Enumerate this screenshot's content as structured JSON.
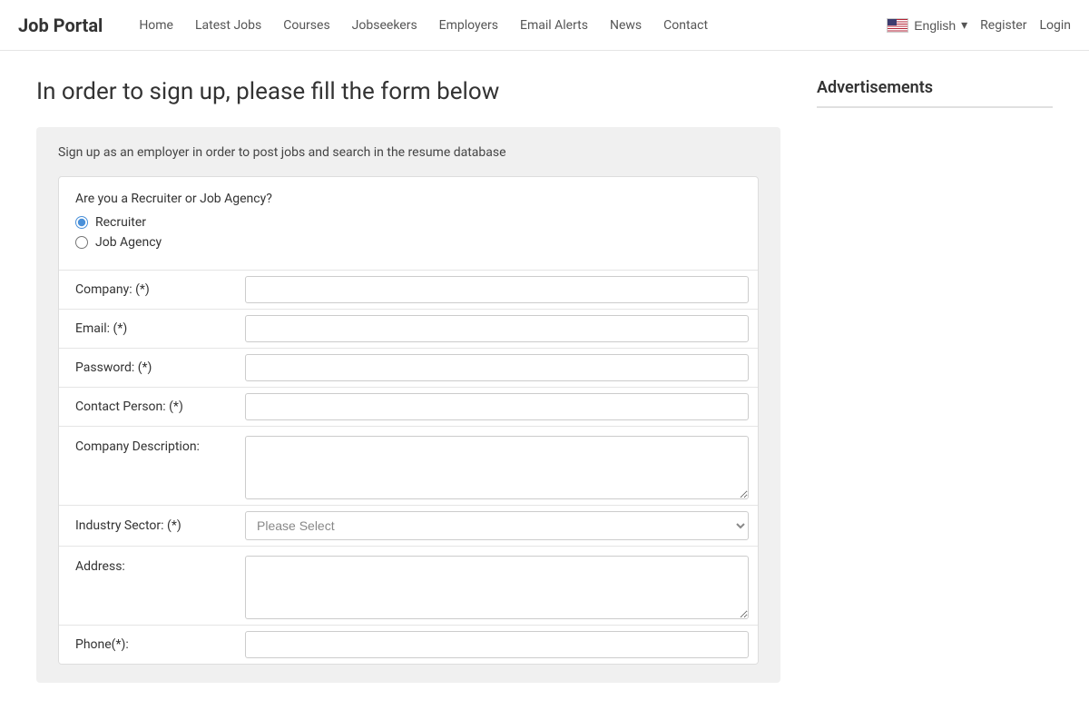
{
  "brand": "Job Portal",
  "nav": {
    "items": [
      {
        "label": "Home",
        "id": "home"
      },
      {
        "label": "Latest Jobs",
        "id": "latest-jobs"
      },
      {
        "label": "Courses",
        "id": "courses"
      },
      {
        "label": "Jobseekers",
        "id": "jobseekers"
      },
      {
        "label": "Employers",
        "id": "employers"
      },
      {
        "label": "Email Alerts",
        "id": "email-alerts"
      },
      {
        "label": "News",
        "id": "news"
      },
      {
        "label": "Contact",
        "id": "contact"
      }
    ],
    "language": "English",
    "register": "Register",
    "login": "Login"
  },
  "page": {
    "title": "In order to sign up, please fill the form below",
    "form_subtitle": "Sign up as an employer in order to post jobs and search in the resume database"
  },
  "form": {
    "radio_question": "Are you a Recruiter or Job Agency?",
    "radio_options": [
      {
        "label": "Recruiter",
        "value": "recruiter",
        "checked": true
      },
      {
        "label": "Job Agency",
        "value": "job_agency",
        "checked": false
      }
    ],
    "fields": [
      {
        "label": "Company: (*)",
        "type": "text",
        "id": "company",
        "placeholder": ""
      },
      {
        "label": "Email: (*)",
        "type": "email",
        "id": "email",
        "placeholder": ""
      },
      {
        "label": "Password: (*)",
        "type": "password",
        "id": "password",
        "placeholder": ""
      },
      {
        "label": "Contact Person: (*)",
        "type": "text",
        "id": "contact_person",
        "placeholder": ""
      }
    ],
    "textarea_field": {
      "label": "Company Description:",
      "id": "company_description"
    },
    "select_field": {
      "label": "Industry Sector: (*)",
      "id": "industry_sector",
      "placeholder": "Please Select",
      "options": [
        "Please Select"
      ]
    },
    "address_field": {
      "label": "Address:",
      "id": "address"
    },
    "phone_field": {
      "label": "Phone(*):",
      "type": "text",
      "id": "phone"
    }
  },
  "sidebar": {
    "ads_title": "Advertisements"
  }
}
